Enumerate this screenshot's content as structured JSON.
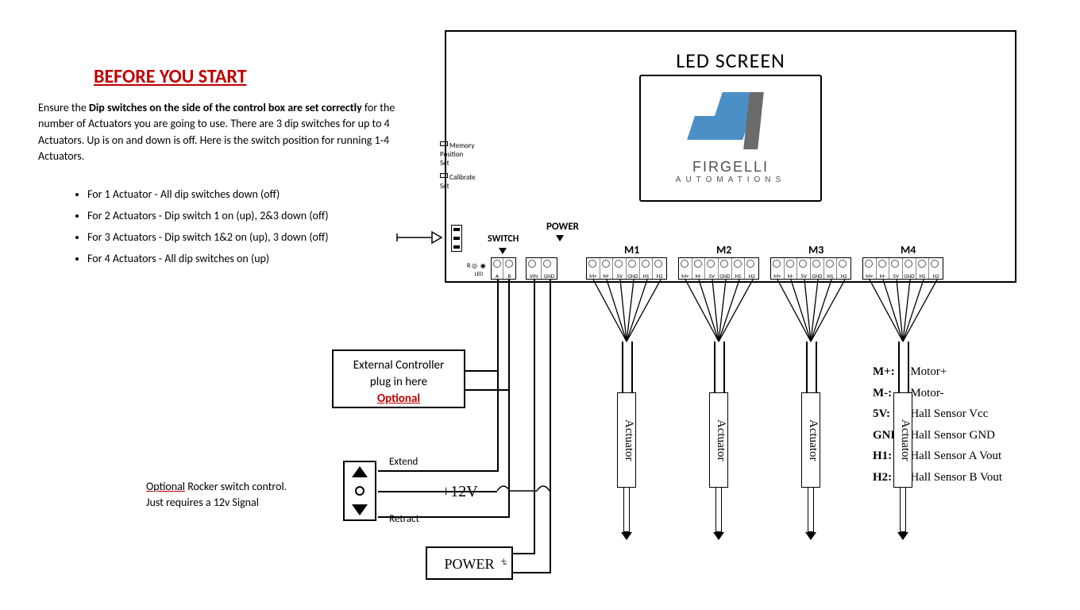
{
  "title": "BEFORE YOU START",
  "intro_prefix": "Ensure the ",
  "intro_bold": "Dip switches on the side of the control box are set correctly",
  "intro_suffix": " for the number of Actuators you are going to use.  There are 3 dip switches for up to 4 Actuators. Up is on and down is off. Here is the switch position for running 1-4 Actuators.",
  "bullets": [
    "For 1 Actuator  -  All dip switches down (off)",
    "For 2 Actuators  -  Dip switch 1 on (up),  2&3 down (off)",
    "For 3 Actuators  -  Dip switch 1&2 on (up),  3 down (off)",
    "For 4 Actuators  -  All dip switches on (up)"
  ],
  "led_title": "LED SCREEN",
  "brand": "FIRGELLI",
  "brand_sub": "AUTOMATIONS",
  "side_buttons": {
    "memory": "Memory\nPosition\nSet",
    "calibrate": "Calibrate\nSet"
  },
  "conn_labels": {
    "switch": "SWITCH",
    "power": "POWER",
    "m1": "M1",
    "m2": "M2",
    "m3": "M3",
    "m4": "M4"
  },
  "pins": [
    "M+",
    "M-",
    "5V",
    "GND",
    "H1",
    "H2"
  ],
  "switch_pins": [
    "A",
    "B"
  ],
  "power_pins": [
    "VIN",
    "GND"
  ],
  "ext_ctrl_l1": "External Controller",
  "ext_ctrl_l2": "plug in here",
  "ext_ctrl_opt": "Optional",
  "rocker": {
    "extend": "Extend",
    "retract": "Retract"
  },
  "plus12": "+12V",
  "power_box": "POWER",
  "actuator_label": "Actuator",
  "rocker_note_opt": "Optional",
  "rocker_note_rest": " Rocker switch control.\nJust requires a 12v Signal",
  "legend": [
    [
      "M+:",
      "Motor+"
    ],
    [
      "M-:",
      "Motor-"
    ],
    [
      "5V:",
      "Hall Sensor Vcc"
    ],
    [
      "GND:",
      "Hall Sensor GND"
    ],
    [
      "H1:",
      "Hall Sensor A Vout"
    ],
    [
      "H2:",
      "Hall Sensor B Vout"
    ]
  ]
}
